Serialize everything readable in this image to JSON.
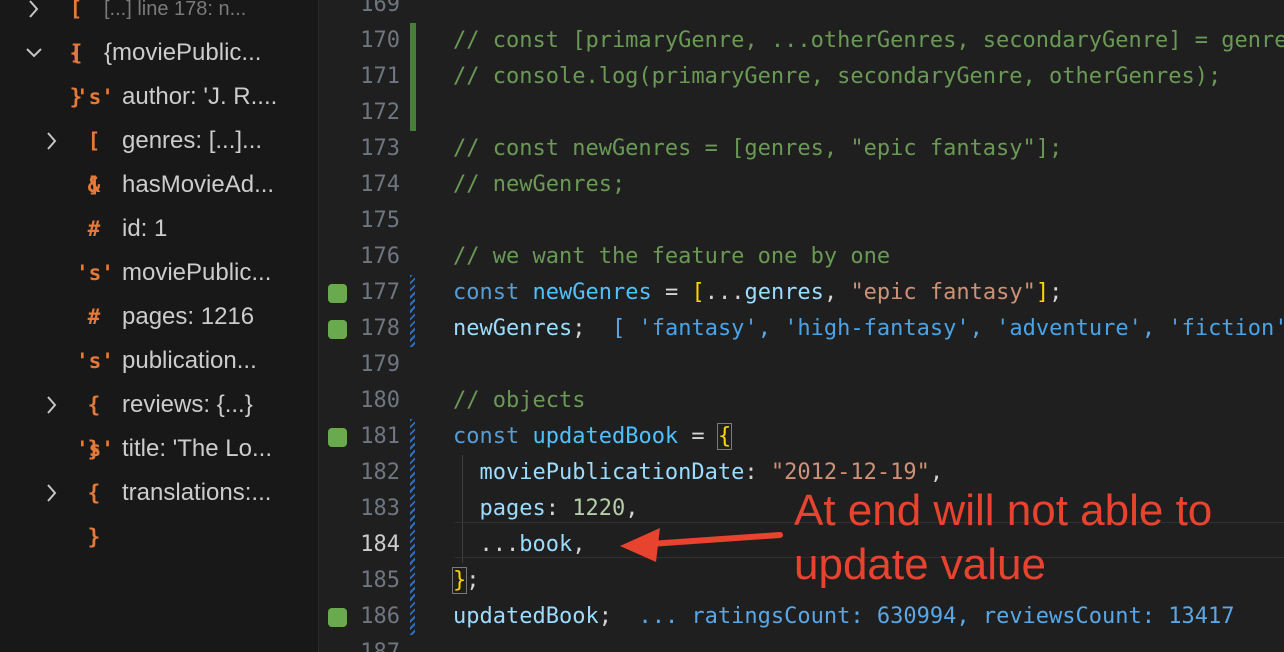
{
  "sidebar": {
    "items": [
      {
        "icon": "[ ]",
        "label": "[...] line 178: n...",
        "twisty": "right",
        "icon_color": "#e5793a"
      },
      {
        "icon": "{ }",
        "label": "{moviePublic...",
        "twisty": "down"
      },
      {
        "icon": "'s'",
        "label": "author: 'J. R....",
        "twisty": ""
      },
      {
        "icon": "[ ]",
        "label": "genres: [...]...",
        "twisty": "right"
      },
      {
        "icon": "&",
        "label": "hasMovieAd...",
        "twisty": ""
      },
      {
        "icon": "#",
        "label": "id: 1",
        "twisty": ""
      },
      {
        "icon": "'s'",
        "label": "moviePublic...",
        "twisty": ""
      },
      {
        "icon": "#",
        "label": "pages: 1216",
        "twisty": ""
      },
      {
        "icon": "'s'",
        "label": "publication...",
        "twisty": ""
      },
      {
        "icon": "{ }",
        "label": "reviews: {...}",
        "twisty": "right"
      },
      {
        "icon": "'s'",
        "label": "title: 'The Lo...",
        "twisty": ""
      },
      {
        "icon": "{ }",
        "label": "translations:...",
        "twisty": "right"
      }
    ]
  },
  "editor": {
    "current_line": "184",
    "lines": [
      {
        "num": "169",
        "segments": []
      },
      {
        "num": "170",
        "segments": [
          {
            "t": "// const [primaryGenre, ...otherGenres, secondaryGenre] = genres;",
            "c": "c-comment"
          }
        ]
      },
      {
        "num": "171",
        "segments": [
          {
            "t": "// console.log(primaryGenre, secondaryGenre, otherGenres);",
            "c": "c-comment"
          }
        ]
      },
      {
        "num": "172",
        "segments": []
      },
      {
        "num": "173",
        "segments": [
          {
            "t": "// const newGenres = [genres, \"epic fantasy\"];",
            "c": "c-comment"
          }
        ]
      },
      {
        "num": "174",
        "segments": [
          {
            "t": "// newGenres;",
            "c": "c-comment"
          }
        ]
      },
      {
        "num": "175",
        "segments": []
      },
      {
        "num": "176",
        "segments": [
          {
            "t": "// we want the feature one by one",
            "c": "c-comment"
          }
        ]
      },
      {
        "num": "177",
        "segments": [
          {
            "t": "const ",
            "c": "c-kw"
          },
          {
            "t": "newGenres",
            "c": "c-var"
          },
          {
            "t": " = ",
            "c": "c-op"
          },
          {
            "t": "[",
            "c": "c-brace"
          },
          {
            "t": "...",
            "c": "c-op"
          },
          {
            "t": "genres",
            "c": "c-prop"
          },
          {
            "t": ", ",
            "c": "c-op"
          },
          {
            "t": "\"epic fantasy\"",
            "c": "c-str"
          },
          {
            "t": "]",
            "c": "c-brace"
          },
          {
            "t": ";",
            "c": "c-op"
          }
        ]
      },
      {
        "num": "178",
        "segments": [
          {
            "t": "newGenres",
            "c": "c-prop"
          },
          {
            "t": ";  ",
            "c": "c-op"
          },
          {
            "t": "[ ",
            "c": "c-inl"
          },
          {
            "t": "'fantasy'",
            "c": "c-str2"
          },
          {
            "t": ", ",
            "c": "c-inl"
          },
          {
            "t": "'high-fantasy'",
            "c": "c-str2"
          },
          {
            "t": ", ",
            "c": "c-inl"
          },
          {
            "t": "'adventure'",
            "c": "c-str2"
          },
          {
            "t": ", ",
            "c": "c-inl"
          },
          {
            "t": "'fiction'",
            "c": "c-str2"
          }
        ]
      },
      {
        "num": "179",
        "segments": []
      },
      {
        "num": "180",
        "segments": [
          {
            "t": "// objects",
            "c": "c-comment"
          }
        ]
      },
      {
        "num": "181",
        "segments": [
          {
            "t": "const ",
            "c": "c-kw"
          },
          {
            "t": "updatedBook",
            "c": "c-var"
          },
          {
            "t": " = ",
            "c": "c-op"
          },
          {
            "t": "{",
            "c": "c-brace bracket-box"
          }
        ]
      },
      {
        "num": "182",
        "segments": [
          {
            "t": "  moviePublicationDate",
            "c": "c-prop"
          },
          {
            "t": ": ",
            "c": "c-op"
          },
          {
            "t": "\"2012-12-19\"",
            "c": "c-str"
          },
          {
            "t": ",",
            "c": "c-op"
          }
        ]
      },
      {
        "num": "183",
        "segments": [
          {
            "t": "  pages",
            "c": "c-prop"
          },
          {
            "t": ": ",
            "c": "c-op"
          },
          {
            "t": "1220",
            "c": "c-num"
          },
          {
            "t": ",",
            "c": "c-op"
          }
        ]
      },
      {
        "num": "184",
        "segments": [
          {
            "t": "  ...",
            "c": "c-op"
          },
          {
            "t": "book",
            "c": "c-prop"
          },
          {
            "t": ",",
            "c": "c-op"
          }
        ]
      },
      {
        "num": "185",
        "segments": [
          {
            "t": "}",
            "c": "c-brace bracket-box"
          },
          {
            "t": ";",
            "c": "c-op"
          }
        ]
      },
      {
        "num": "186",
        "segments": [
          {
            "t": "updatedBook",
            "c": "c-prop"
          },
          {
            "t": ";  ",
            "c": "c-op"
          },
          {
            "t": "... ratingsCount: 630994, reviewsCount: 13417",
            "c": "c-inl"
          }
        ]
      },
      {
        "num": "187",
        "segments": []
      }
    ],
    "breakpoints": [
      "177",
      "178",
      "181",
      "186"
    ],
    "green_gutter": [
      "170",
      "171",
      "172"
    ],
    "blue_gutter": [
      "177",
      "178",
      "181",
      "182",
      "183",
      "184",
      "185",
      "186"
    ],
    "indent_guides": [
      "182",
      "183",
      "184"
    ]
  },
  "annotation": {
    "text_line1": "At end will not able to",
    "text_line2": "update value",
    "color": "#e8432f"
  }
}
